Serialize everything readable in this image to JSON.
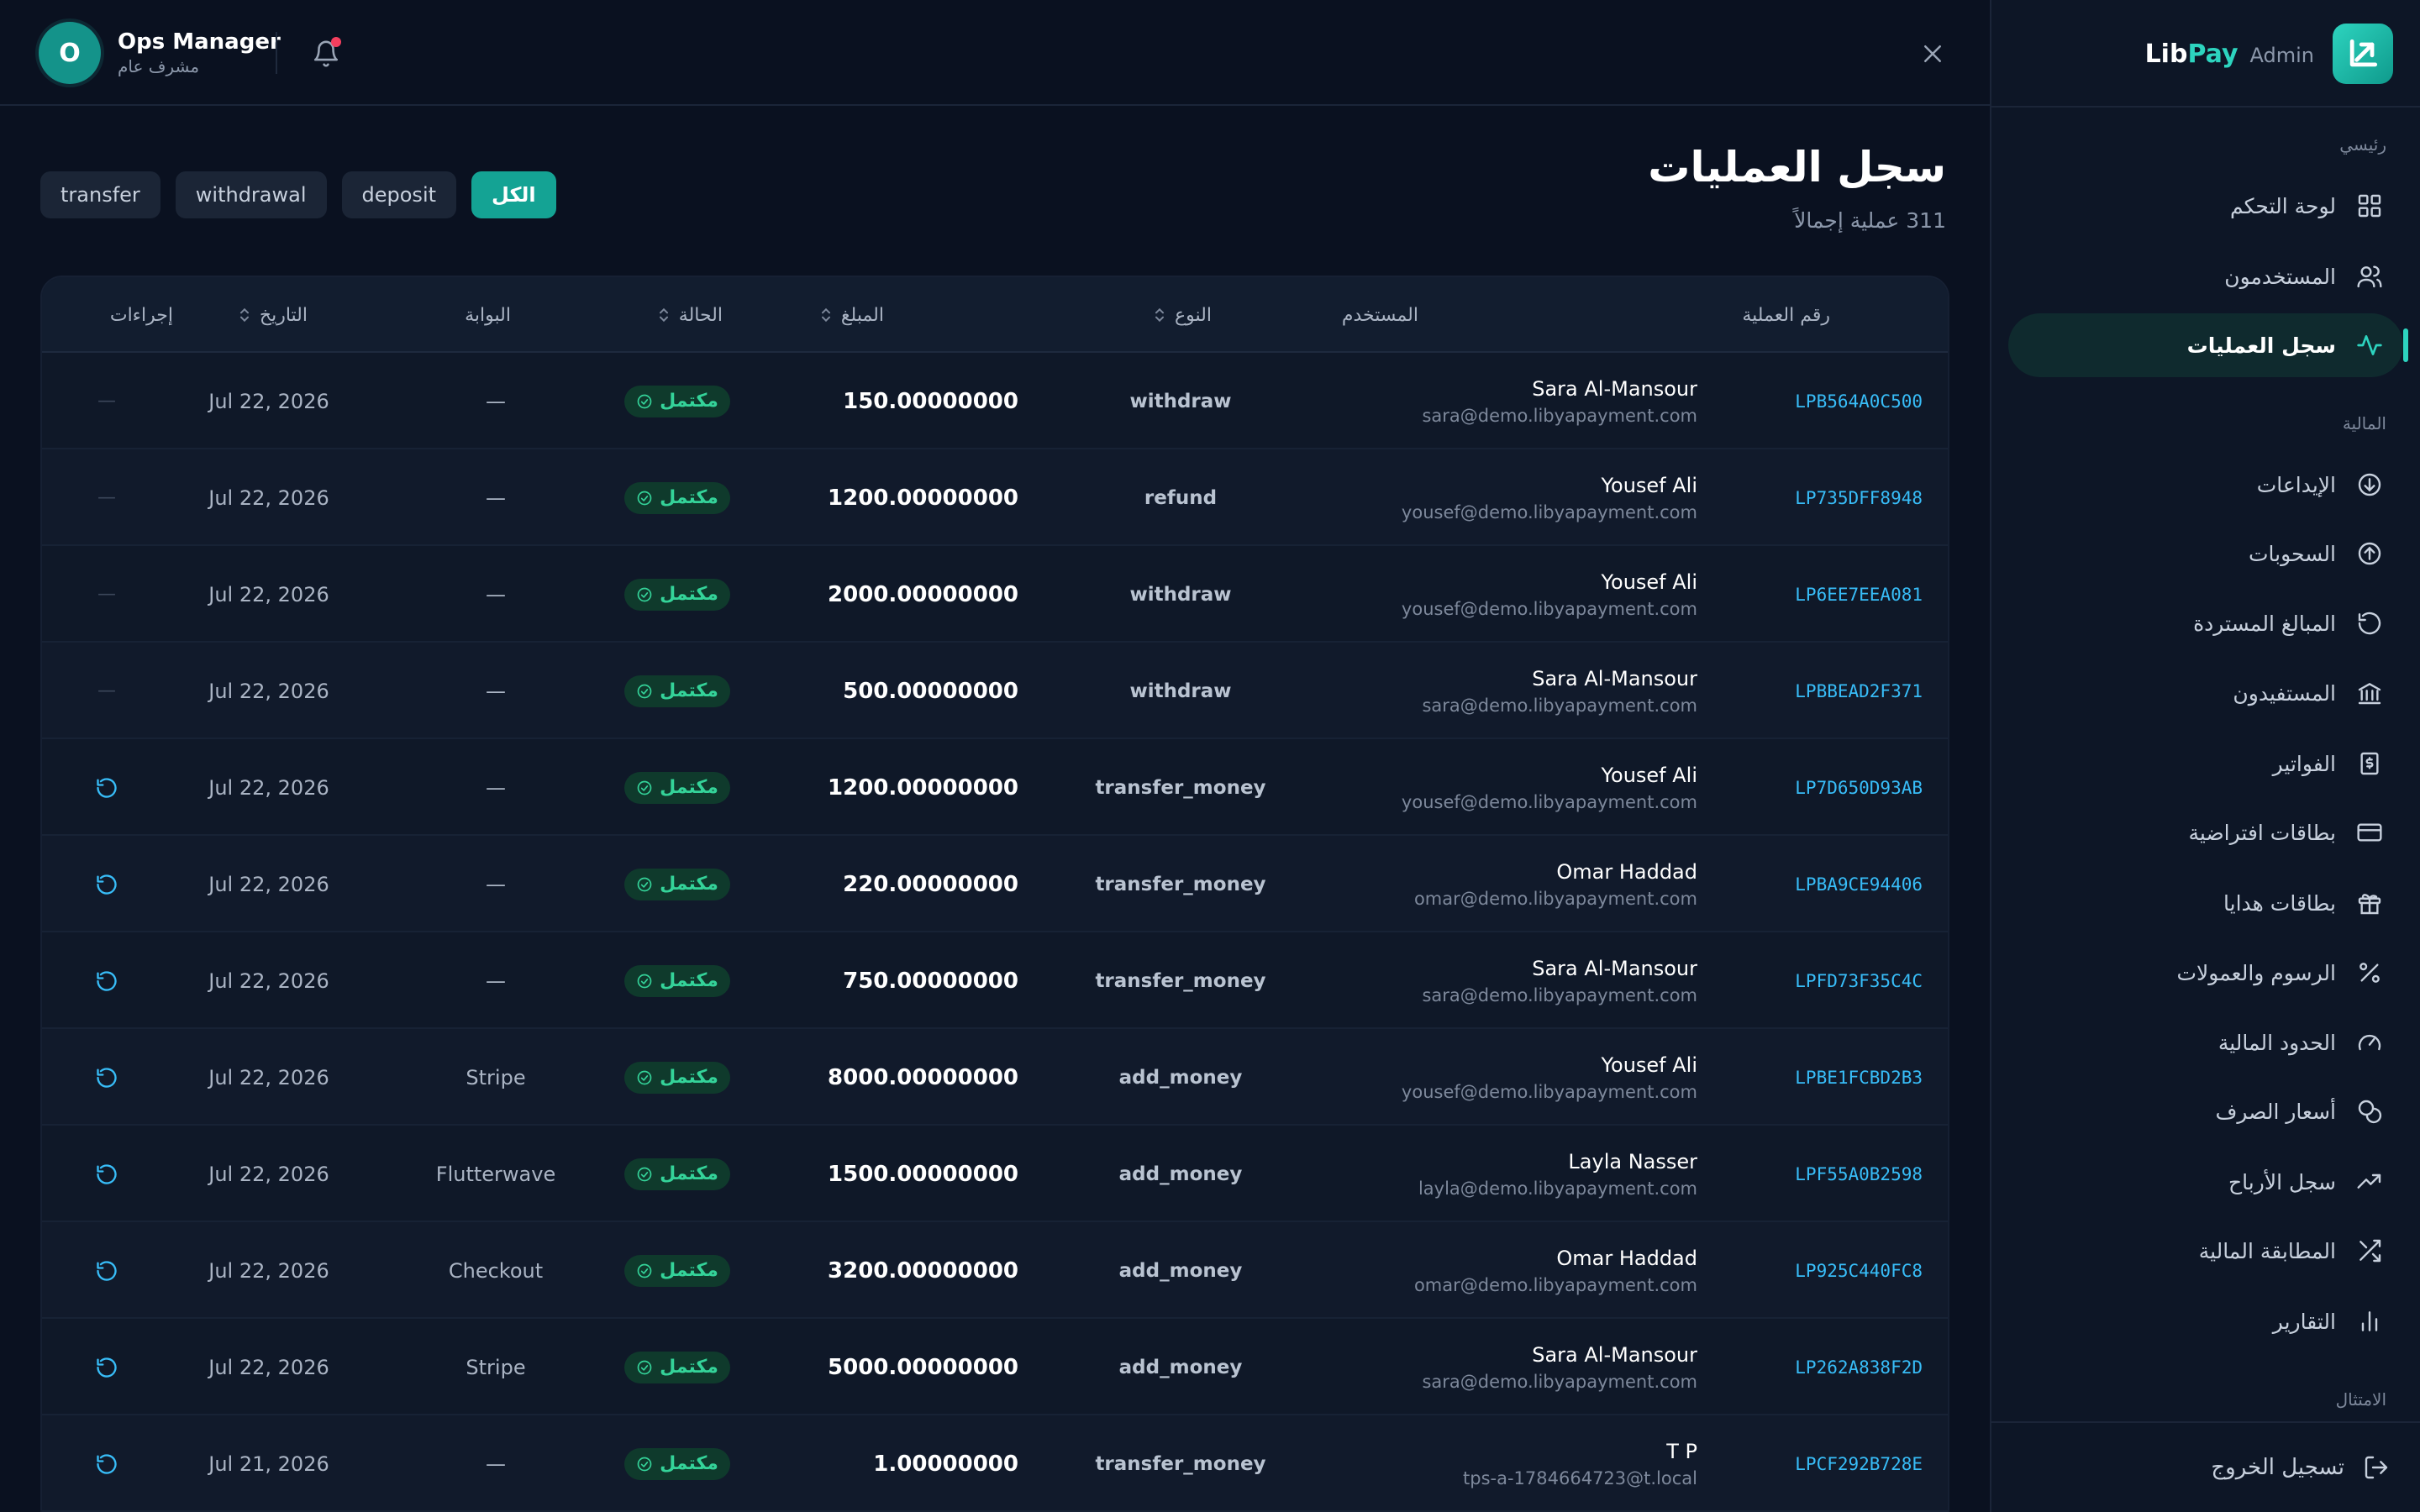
{
  "brand": {
    "lib": "Lib",
    "pay": "Pay",
    "admin": "Admin"
  },
  "header": {
    "user_name": "Ops Manager",
    "user_role": "مشرف عام",
    "avatar_initial": "O"
  },
  "sidebar": {
    "sections": {
      "main": "رئيسي",
      "finance": "المالية",
      "compliance": "الامتثال"
    },
    "items": [
      {
        "label": "لوحة التحكم",
        "icon": "dashboard-icon"
      },
      {
        "label": "المستخدمون",
        "icon": "users-icon"
      },
      {
        "label": "سجل العمليات",
        "icon": "activity-icon",
        "active": true
      },
      {
        "label": "الإيداعات",
        "icon": "arrow-down-circle-icon"
      },
      {
        "label": "السحوبات",
        "icon": "arrow-up-circle-icon"
      },
      {
        "label": "المبالغ المستردة",
        "icon": "refund-icon"
      },
      {
        "label": "المستفيدون",
        "icon": "bank-icon"
      },
      {
        "label": "الفواتير",
        "icon": "invoice-icon"
      },
      {
        "label": "بطاقات افتراضية",
        "icon": "card-icon"
      },
      {
        "label": "بطاقات هدايا",
        "icon": "gift-icon"
      },
      {
        "label": "الرسوم والعمولات",
        "icon": "percent-icon"
      },
      {
        "label": "الحدود المالية",
        "icon": "gauge-icon"
      },
      {
        "label": "أسعار الصرف",
        "icon": "coins-icon"
      },
      {
        "label": "سجل الأرباح",
        "icon": "trending-up-icon"
      },
      {
        "label": "المطابقة المالية",
        "icon": "shuffle-icon"
      },
      {
        "label": "التقارير",
        "icon": "bar-chart-icon"
      }
    ],
    "logout": "تسجيل الخروج"
  },
  "page": {
    "title": "سجل العمليات",
    "subtitle": "311 عملية إجمالاً"
  },
  "filters": [
    {
      "label": "الكل",
      "active": true
    },
    {
      "label": "deposit"
    },
    {
      "label": "withdrawal"
    },
    {
      "label": "transfer"
    }
  ],
  "table": {
    "columns": {
      "id": "رقم العملية",
      "user": "المستخدم",
      "type": "النوع",
      "amount": "المبلغ",
      "status": "الحالة",
      "gateway": "البوابة",
      "date": "التاريخ",
      "actions": "إجراءات"
    },
    "rows": [
      {
        "id": "LPB564A0C500",
        "name": "Sara Al-Mansour",
        "email": "sara@demo.libyapayment.com",
        "type": "withdraw",
        "amount": "150.00000000",
        "status": "مكتمل",
        "gateway": "—",
        "date": "Jul 22, 2026",
        "action": "—"
      },
      {
        "id": "LP735DFF8948",
        "name": "Yousef Ali",
        "email": "yousef@demo.libyapayment.com",
        "type": "refund",
        "amount": "1200.00000000",
        "status": "مكتمل",
        "gateway": "—",
        "date": "Jul 22, 2026",
        "action": "—"
      },
      {
        "id": "LP6EE7EEA081",
        "name": "Yousef Ali",
        "email": "yousef@demo.libyapayment.com",
        "type": "withdraw",
        "amount": "2000.00000000",
        "status": "مكتمل",
        "gateway": "—",
        "date": "Jul 22, 2026",
        "action": "—"
      },
      {
        "id": "LPBBEAD2F371",
        "name": "Sara Al-Mansour",
        "email": "sara@demo.libyapayment.com",
        "type": "withdraw",
        "amount": "500.00000000",
        "status": "مكتمل",
        "gateway": "—",
        "date": "Jul 22, 2026",
        "action": "—"
      },
      {
        "id": "LP7D650D93AB",
        "name": "Yousef Ali",
        "email": "yousef@demo.libyapayment.com",
        "type": "transfer_money",
        "amount": "1200.00000000",
        "status": "مكتمل",
        "gateway": "—",
        "date": "Jul 22, 2026",
        "action": "refund"
      },
      {
        "id": "LPBA9CE94406",
        "name": "Omar Haddad",
        "email": "omar@demo.libyapayment.com",
        "type": "transfer_money",
        "amount": "220.00000000",
        "status": "مكتمل",
        "gateway": "—",
        "date": "Jul 22, 2026",
        "action": "refund"
      },
      {
        "id": "LPFD73F35C4C",
        "name": "Sara Al-Mansour",
        "email": "sara@demo.libyapayment.com",
        "type": "transfer_money",
        "amount": "750.00000000",
        "status": "مكتمل",
        "gateway": "—",
        "date": "Jul 22, 2026",
        "action": "refund"
      },
      {
        "id": "LPBE1FCBD2B3",
        "name": "Yousef Ali",
        "email": "yousef@demo.libyapayment.com",
        "type": "add_money",
        "amount": "8000.00000000",
        "status": "مكتمل",
        "gateway": "Stripe",
        "date": "Jul 22, 2026",
        "action": "refund"
      },
      {
        "id": "LPF55A0B2598",
        "name": "Layla Nasser",
        "email": "layla@demo.libyapayment.com",
        "type": "add_money",
        "amount": "1500.00000000",
        "status": "مكتمل",
        "gateway": "Flutterwave",
        "date": "Jul 22, 2026",
        "action": "refund"
      },
      {
        "id": "LP925C440FC8",
        "name": "Omar Haddad",
        "email": "omar@demo.libyapayment.com",
        "type": "add_money",
        "amount": "3200.00000000",
        "status": "مكتمل",
        "gateway": "Checkout",
        "date": "Jul 22, 2026",
        "action": "refund"
      },
      {
        "id": "LP262A838F2D",
        "name": "Sara Al-Mansour",
        "email": "sara@demo.libyapayment.com",
        "type": "add_money",
        "amount": "5000.00000000",
        "status": "مكتمل",
        "gateway": "Stripe",
        "date": "Jul 22, 2026",
        "action": "refund"
      },
      {
        "id": "LPCF292B728E",
        "name": "T P",
        "email": "tps-a-1784664723@t.local",
        "type": "transfer_money",
        "amount": "1.00000000",
        "status": "مكتمل",
        "gateway": "—",
        "date": "Jul 21, 2026",
        "action": "refund"
      }
    ]
  },
  "colors": {
    "accent": "#2dd4bf",
    "link": "#38bdf8",
    "success": "#34d399",
    "notification": "#f43f5e"
  }
}
